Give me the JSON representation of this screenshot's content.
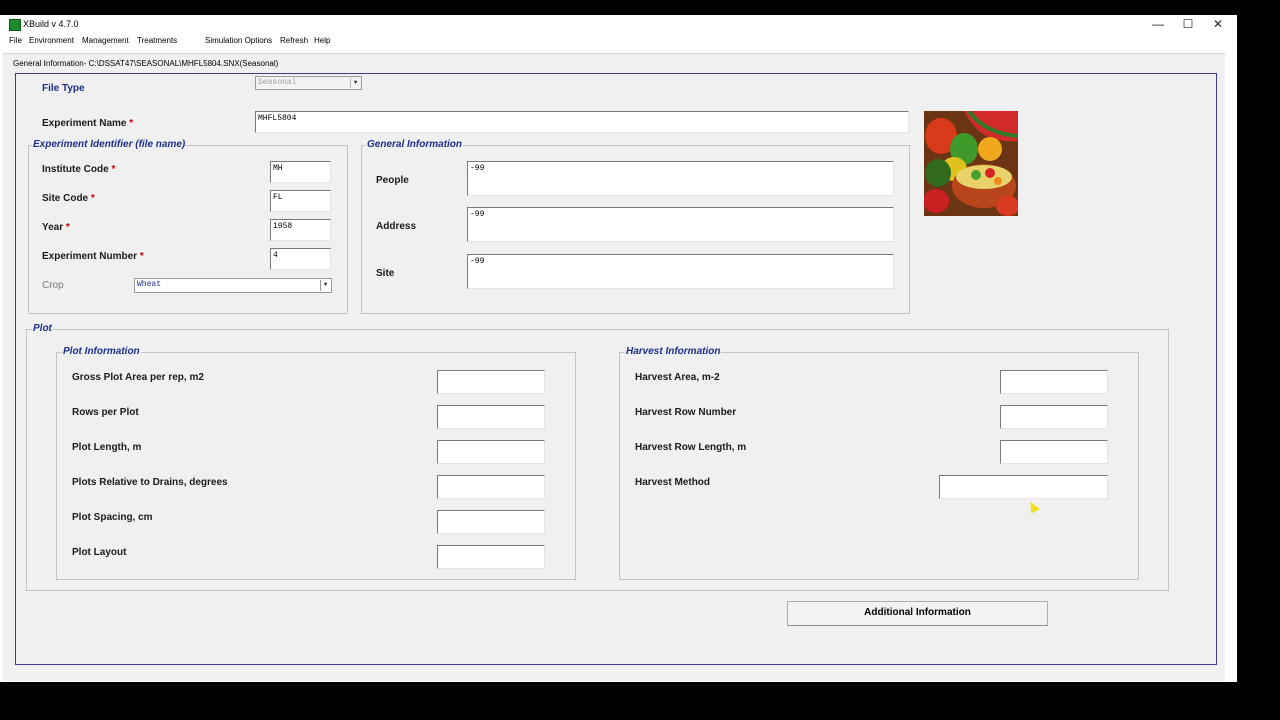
{
  "window": {
    "title": "XBuild v 4.7.0",
    "controls": {
      "minimize": "—",
      "maximize": "☐",
      "close": "✕"
    }
  },
  "menu": [
    "File",
    "Environment",
    "Management",
    "Treatments",
    "Simulation Options",
    "Refresh",
    "Help"
  ],
  "path": "General Information- C:\\DSSAT47\\SEASONAL\\MHFL5804.SNX(Seasonal)",
  "file_type": {
    "label": "File Type",
    "value": "Seasonal"
  },
  "experiment_name": {
    "label": "Experiment Name",
    "required": "*",
    "value": "MHFL5804"
  },
  "experiment_identifier": {
    "title": "Experiment Identifier (file name)",
    "institute_code": {
      "label": "Institute Code",
      "required": "*",
      "value": "MH"
    },
    "site_code": {
      "label": "Site Code",
      "required": "*",
      "value": "FL"
    },
    "year": {
      "label": "Year",
      "required": "*",
      "value": "1958"
    },
    "experiment_number": {
      "label": "Experiment Number",
      "required": "*",
      "value": "4"
    },
    "crop": {
      "label": "Crop",
      "value": "Wheat"
    }
  },
  "general_information": {
    "title": "General Information",
    "people": {
      "label": "People",
      "value": "-99"
    },
    "address": {
      "label": "Address",
      "value": "-99"
    },
    "site": {
      "label": "Site",
      "value": "-99"
    }
  },
  "plot": {
    "title": "Plot",
    "plot_information": {
      "title": "Plot Information",
      "fields": [
        {
          "label": "Gross Plot Area per rep, m2",
          "value": ""
        },
        {
          "label": "Rows per Plot",
          "value": ""
        },
        {
          "label": "Plot Length, m",
          "value": ""
        },
        {
          "label": "Plots Relative to Drains, degrees",
          "value": ""
        },
        {
          "label": "Plot Spacing, cm",
          "value": ""
        },
        {
          "label": "Plot Layout",
          "value": ""
        }
      ]
    },
    "harvest_information": {
      "title": "Harvest Information",
      "fields": [
        {
          "label": "Harvest Area, m-2",
          "value": ""
        },
        {
          "label": "Harvest Row Number",
          "value": ""
        },
        {
          "label": "Harvest Row Length, m",
          "value": ""
        },
        {
          "label": "Harvest Method",
          "value": ""
        }
      ]
    }
  },
  "additional_info_button": "Additional Information",
  "icons": {
    "app": "xbuild-app-icon",
    "image": "vegetables-fruits-photo",
    "dropdown": "chevron-down-icon",
    "cursor": "mouse-cursor-icon"
  },
  "colors": {
    "label_blue": "#1c2f8c",
    "required_red": "#c00000",
    "panel_bg": "#f0f0f0"
  }
}
